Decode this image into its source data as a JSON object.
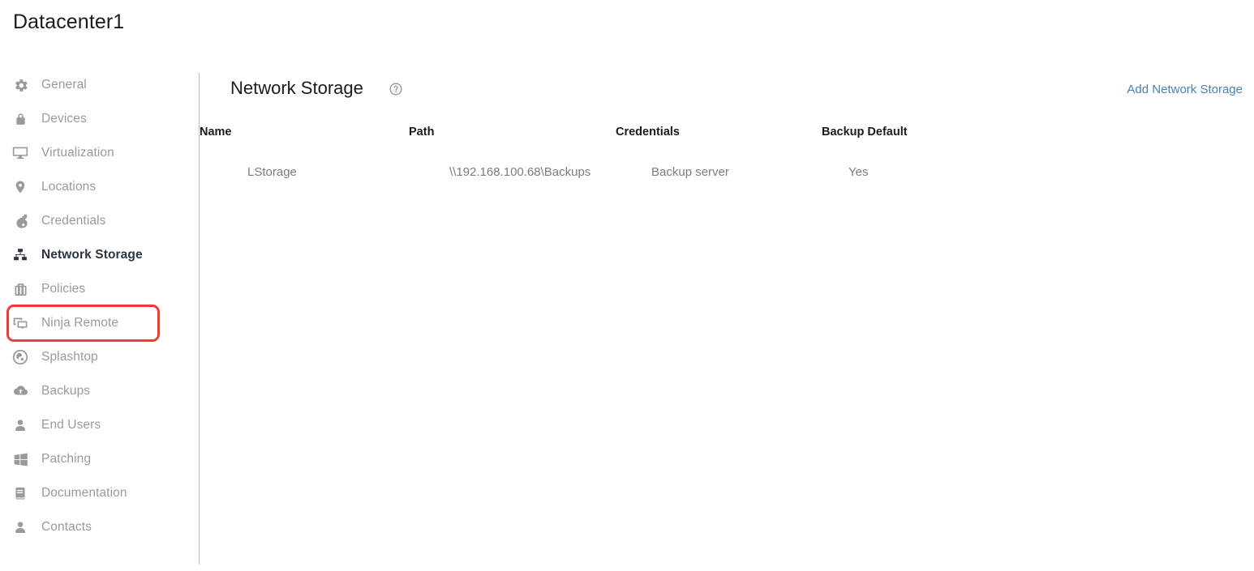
{
  "page": {
    "title": "Datacenter1"
  },
  "sidebar": {
    "items": [
      {
        "label": "General",
        "icon": "gear-icon",
        "selected": false
      },
      {
        "label": "Devices",
        "icon": "lock-icon",
        "selected": false
      },
      {
        "label": "Virtualization",
        "icon": "monitor-icon",
        "selected": false
      },
      {
        "label": "Locations",
        "icon": "map-pin-icon",
        "selected": false
      },
      {
        "label": "Credentials",
        "icon": "key-icon",
        "selected": false
      },
      {
        "label": "Network Storage",
        "icon": "sitemap-icon",
        "selected": true
      },
      {
        "label": "Policies",
        "icon": "briefcase-icon",
        "selected": false
      },
      {
        "label": "Ninja Remote",
        "icon": "dual-monitor-icon",
        "selected": false
      },
      {
        "label": "Splashtop",
        "icon": "splashtop-logo-icon",
        "selected": false
      },
      {
        "label": "Backups",
        "icon": "cloud-upload-icon",
        "selected": false
      },
      {
        "label": "End Users",
        "icon": "user-icon",
        "selected": false
      },
      {
        "label": "Patching",
        "icon": "windows-icon",
        "selected": false
      },
      {
        "label": "Documentation",
        "icon": "book-icon",
        "selected": false
      },
      {
        "label": "Contacts",
        "icon": "user-icon",
        "selected": false
      }
    ]
  },
  "main": {
    "section_title": "Network Storage",
    "help_icon": "question-circle-icon",
    "add_link_label": "Add Network Storage",
    "table": {
      "columns": [
        "Name",
        "Path",
        "Credentials",
        "Backup Default"
      ],
      "rows": [
        {
          "name": "LStorage",
          "path": "\\\\192.168.100.68\\Backups",
          "credentials": "Backup server",
          "backup_default": "Yes"
        }
      ]
    }
  },
  "colors": {
    "annotation": "#ef3b36",
    "link": "#4a81b4",
    "muted_text": "#9a9a9a",
    "selected_text": "#2b3440"
  }
}
